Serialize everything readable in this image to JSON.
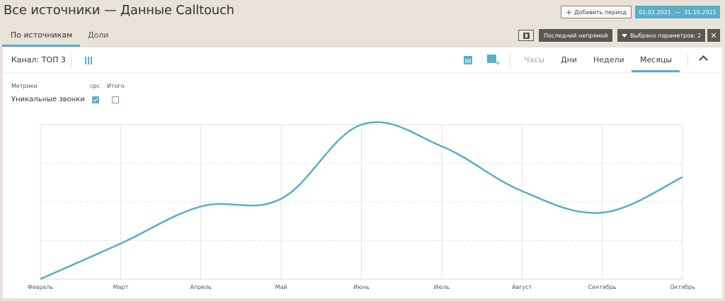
{
  "header": {
    "title": "Все источники — Данные Calltouch",
    "add_period_label": "Добавить период",
    "date_from": "01.02.2021",
    "date_sep": "—",
    "date_to": "31.10.2021"
  },
  "tabs": {
    "sources": "По источникам",
    "shares": "Доли"
  },
  "toolbar": {
    "last_indirect": "Последний непрямой",
    "params_selected": "Выбрано параметров: 2",
    "close": "✕"
  },
  "panel": {
    "channel": "Канал: ТОП 3",
    "periods": [
      "Часы",
      "Дни",
      "Недели",
      "Месяцы"
    ],
    "active_period": "Месяцы"
  },
  "metrics": {
    "header_metrics": "Метрики",
    "header_cpc": "cpc",
    "header_total": "Итого",
    "rows": [
      {
        "name": "Уникальные звонки",
        "cpc_checked": true,
        "total_checked": false
      }
    ]
  },
  "colors": {
    "accent": "#5aaec8",
    "dark_button": "#5b5853",
    "background": "#e8e2d9"
  },
  "chart_data": {
    "type": "line",
    "categories": [
      "Февраль",
      "Март",
      "Апрель",
      "Май",
      "Июнь",
      "Июль",
      "Август",
      "Сентябрь",
      "Октябрь"
    ],
    "series": [
      {
        "values": [
          0,
          23,
          47,
          52,
          100,
          86,
          57,
          43,
          66
        ]
      }
    ],
    "ylim": [
      0,
      100
    ],
    "grid": true,
    "color": "#5aaec8"
  }
}
